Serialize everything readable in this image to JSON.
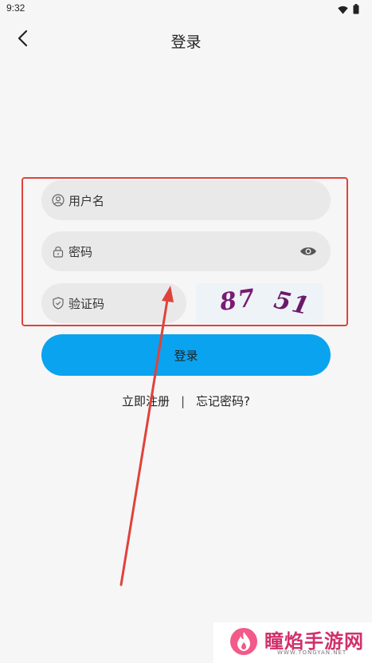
{
  "status_bar": {
    "time": "9:32",
    "icons": [
      "wifi-icon",
      "battery-icon"
    ]
  },
  "nav": {
    "title": "登录",
    "back_icon": "chevron-left-icon"
  },
  "form": {
    "username_placeholder": "用户名",
    "password_placeholder": "密码",
    "captcha_placeholder": "验证码",
    "captcha_code_part1": "87",
    "captcha_code_part2": "51"
  },
  "actions": {
    "login_label": "登录",
    "register_label": "立即注册",
    "separator": "|",
    "forgot_label": "忘记密码?"
  },
  "watermark": {
    "name": "瞳焰手游网",
    "url": "WWW.TONGYAN.NET"
  },
  "colors": {
    "background": "#f6f6f6",
    "field_bg": "#e9e9e9",
    "primary": "#0aa3ef",
    "annotation_red": "#e0423a",
    "captcha_purple": "#7a1a72"
  }
}
